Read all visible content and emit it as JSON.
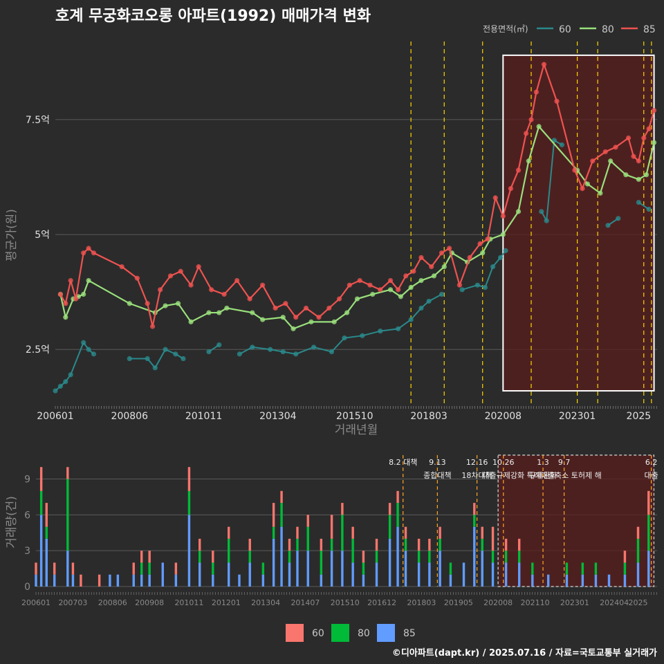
{
  "title": "호계 무궁화코오롱 아파트(1992) 매매가격 변화",
  "caption": "©디아파트(dapt.kr) / 2025.07.16 / 자료=국토교통부 실거래가",
  "colors": {
    "background": "#2b2b2b",
    "s60": "#2a8a8c",
    "s80": "#9ae07c",
    "s85": "#ef5350",
    "bar60": "#f8766d",
    "bar80": "#00ba38",
    "bar85": "#619cff",
    "event": "#ffd700",
    "highlight": "#5a1e1e"
  },
  "chart_data": [
    {
      "type": "line",
      "title": "호계 무궁화코오롱 아파트(1992) 매매가격 변화",
      "xlabel": "거래년월",
      "ylabel": "평균가(원)",
      "y_unit": "억",
      "ylim": [
        1.3,
        9.5
      ],
      "xlim": [
        "2006-01",
        "2025-07"
      ],
      "x_ticks": [
        "200601",
        "200806",
        "201011",
        "201304",
        "201510",
        "201803",
        "202008",
        "202301",
        "2025"
      ],
      "y_ticks": [
        {
          "value": 2.5,
          "label": "2.5억"
        },
        {
          "value": 5,
          "label": "5억"
        },
        {
          "value": 7.5,
          "label": "7.5억"
        }
      ],
      "grid": true,
      "legend": {
        "title": "전용면적(㎡)",
        "position": "top-right",
        "entries": [
          "60",
          "80",
          "85"
        ]
      },
      "highlight_box": {
        "from": "2020-08",
        "to": "2025-07",
        "ymin": 1.6,
        "ymax": 8.9
      },
      "event_lines": [
        "2017-08",
        "2018-09",
        "2019-12",
        "2021-07",
        "2023-01",
        "2023-09",
        "2025-03",
        "2025-06"
      ],
      "series": [
        {
          "name": "60",
          "points": [
            [
              "2006-01",
              1.6
            ],
            [
              "2006-03",
              1.7
            ],
            [
              "2006-05",
              1.8
            ],
            [
              "2006-07",
              1.95
            ],
            [
              "2006-12",
              2.65
            ],
            [
              "2007-02",
              2.5
            ],
            [
              "2007-04",
              2.4
            ],
            [
              "2008-06",
              2.3
            ],
            [
              "2009-01",
              2.3
            ],
            [
              "2009-04",
              2.1
            ],
            [
              "2009-08",
              2.5
            ],
            [
              "2009-12",
              2.4
            ],
            [
              "2010-03",
              2.3
            ],
            [
              "2011-01",
              2.45
            ],
            [
              "2011-05",
              2.6
            ],
            [
              "2012-01",
              2.4
            ],
            [
              "2012-06",
              2.55
            ],
            [
              "2013-01",
              2.5
            ],
            [
              "2013-06",
              2.45
            ],
            [
              "2013-11",
              2.4
            ],
            [
              "2014-06",
              2.55
            ],
            [
              "2015-01",
              2.45
            ],
            [
              "2015-06",
              2.75
            ],
            [
              "2016-01",
              2.8
            ],
            [
              "2016-08",
              2.9
            ],
            [
              "2017-03",
              2.95
            ],
            [
              "2017-08",
              3.15
            ],
            [
              "2017-12",
              3.4
            ],
            [
              "2018-03",
              3.55
            ],
            [
              "2018-08",
              3.7
            ],
            [
              "2019-04",
              3.8
            ],
            [
              "2019-10",
              3.9
            ],
            [
              "2020-01",
              3.85
            ],
            [
              "2020-04",
              4.3
            ],
            [
              "2020-07",
              4.5
            ],
            [
              "2020-09",
              4.65
            ],
            [
              "2021-11",
              5.5
            ],
            [
              "2022-01",
              5.3
            ],
            [
              "2022-04",
              7.05
            ],
            [
              "2022-07",
              6.95
            ],
            [
              "2024-01",
              5.2
            ],
            [
              "2024-05",
              5.35
            ],
            [
              "2025-01",
              5.7
            ],
            [
              "2025-05",
              5.55
            ]
          ]
        },
        {
          "name": "80",
          "points": [
            [
              "2006-03",
              3.7
            ],
            [
              "2006-05",
              3.2
            ],
            [
              "2006-08",
              3.6
            ],
            [
              "2006-10",
              3.65
            ],
            [
              "2006-12",
              3.7
            ],
            [
              "2007-02",
              4.0
            ],
            [
              "2008-06",
              3.5
            ],
            [
              "2009-04",
              3.3
            ],
            [
              "2009-08",
              3.45
            ],
            [
              "2010-01",
              3.5
            ],
            [
              "2010-06",
              3.1
            ],
            [
              "2011-01",
              3.3
            ],
            [
              "2011-05",
              3.3
            ],
            [
              "2011-08",
              3.4
            ],
            [
              "2012-06",
              3.3
            ],
            [
              "2012-10",
              3.15
            ],
            [
              "2013-06",
              3.2
            ],
            [
              "2013-10",
              2.95
            ],
            [
              "2014-05",
              3.1
            ],
            [
              "2015-02",
              3.1
            ],
            [
              "2015-07",
              3.3
            ],
            [
              "2015-11",
              3.6
            ],
            [
              "2016-05",
              3.7
            ],
            [
              "2016-12",
              3.8
            ],
            [
              "2017-04",
              3.65
            ],
            [
              "2017-08",
              3.85
            ],
            [
              "2017-12",
              4.0
            ],
            [
              "2018-05",
              4.1
            ],
            [
              "2018-09",
              4.3
            ],
            [
              "2018-12",
              4.6
            ],
            [
              "2019-06",
              4.4
            ],
            [
              "2019-12",
              4.6
            ],
            [
              "2020-03",
              4.9
            ],
            [
              "2020-08",
              5.0
            ],
            [
              "2021-02",
              5.5
            ],
            [
              "2021-06",
              6.6
            ],
            [
              "2021-10",
              7.35
            ],
            [
              "2023-01",
              6.4
            ],
            [
              "2023-05",
              6.1
            ],
            [
              "2023-10",
              5.9
            ],
            [
              "2024-02",
              6.6
            ],
            [
              "2024-08",
              6.3
            ],
            [
              "2025-01",
              6.2
            ],
            [
              "2025-04",
              6.3
            ],
            [
              "2025-07",
              7.0
            ]
          ]
        },
        {
          "name": "85",
          "points": [
            [
              "2006-03",
              3.7
            ],
            [
              "2006-05",
              3.5
            ],
            [
              "2006-07",
              4.0
            ],
            [
              "2006-09",
              3.6
            ],
            [
              "2006-12",
              4.6
            ],
            [
              "2007-02",
              4.7
            ],
            [
              "2007-04",
              4.6
            ],
            [
              "2008-03",
              4.3
            ],
            [
              "2008-09",
              4.05
            ],
            [
              "2009-01",
              3.5
            ],
            [
              "2009-03",
              3.0
            ],
            [
              "2009-06",
              3.8
            ],
            [
              "2009-10",
              4.1
            ],
            [
              "2010-02",
              4.2
            ],
            [
              "2010-06",
              3.9
            ],
            [
              "2010-09",
              4.3
            ],
            [
              "2011-02",
              3.8
            ],
            [
              "2011-07",
              3.7
            ],
            [
              "2011-12",
              4.0
            ],
            [
              "2012-05",
              3.6
            ],
            [
              "2012-10",
              3.9
            ],
            [
              "2013-03",
              3.4
            ],
            [
              "2013-07",
              3.5
            ],
            [
              "2013-11",
              3.2
            ],
            [
              "2014-03",
              3.4
            ],
            [
              "2014-08",
              3.2
            ],
            [
              "2014-12",
              3.4
            ],
            [
              "2015-04",
              3.6
            ],
            [
              "2015-08",
              3.9
            ],
            [
              "2015-12",
              4.0
            ],
            [
              "2016-04",
              3.9
            ],
            [
              "2016-08",
              3.8
            ],
            [
              "2016-12",
              4.0
            ],
            [
              "2017-03",
              3.8
            ],
            [
              "2017-06",
              4.1
            ],
            [
              "2017-09",
              4.2
            ],
            [
              "2017-12",
              4.5
            ],
            [
              "2018-04",
              4.3
            ],
            [
              "2018-08",
              4.6
            ],
            [
              "2018-11",
              4.7
            ],
            [
              "2019-03",
              3.9
            ],
            [
              "2019-07",
              4.5
            ],
            [
              "2019-11",
              4.8
            ],
            [
              "2020-02",
              4.9
            ],
            [
              "2020-05",
              5.8
            ],
            [
              "2020-08",
              5.4
            ],
            [
              "2020-11",
              6.0
            ],
            [
              "2021-02",
              6.4
            ],
            [
              "2021-05",
              7.2
            ],
            [
              "2021-07",
              7.5
            ],
            [
              "2021-09",
              8.1
            ],
            [
              "2021-12",
              8.7
            ],
            [
              "2022-05",
              7.9
            ],
            [
              "2022-12",
              6.4
            ],
            [
              "2023-03",
              6.0
            ],
            [
              "2023-07",
              6.6
            ],
            [
              "2023-12",
              6.8
            ],
            [
              "2024-04",
              6.9
            ],
            [
              "2024-09",
              7.1
            ],
            [
              "2024-11",
              6.7
            ],
            [
              "2025-01",
              6.6
            ],
            [
              "2025-03",
              7.1
            ],
            [
              "2025-05",
              7.3
            ],
            [
              "2025-07",
              7.7
            ]
          ]
        }
      ]
    },
    {
      "type": "bar",
      "xlabel": "",
      "ylabel": "거래량(건)",
      "ylim": [
        0,
        11
      ],
      "y_ticks": [
        0,
        3,
        6,
        9
      ],
      "x_ticks": [
        "200601",
        "200703",
        "200806",
        "200908",
        "201011",
        "201201",
        "201304",
        "201407",
        "201510",
        "201612",
        "201803",
        "201905",
        "202008",
        "202110",
        "202301",
        "202404",
        "2025"
      ],
      "legend": {
        "position": "bottom",
        "entries": [
          "60",
          "80",
          "85"
        ]
      },
      "highlight_box": {
        "from": "2020-08",
        "to": "2025-07"
      },
      "events": [
        {
          "date": "2017-08",
          "line1": "8.2 대책",
          "line2": ""
        },
        {
          "date": "2018-09",
          "line1": "9.13",
          "line2": "종합대책"
        },
        {
          "date": "2019-12",
          "line1": "12.16",
          "line2": "18차대책"
        },
        {
          "date": "2020-10",
          "line1": "10.26",
          "line2": "대출규제강화"
        },
        {
          "date": "2022-01",
          "line1": "1.3",
          "line2": "규제완화"
        },
        {
          "date": "2022-09",
          "line1": "9.7",
          "line2": "특례대출축소 토허제 해"
        },
        {
          "date": "2025-06",
          "line1": "6.2",
          "line2": "대출"
        }
      ],
      "stacks": [
        [
          "2006-01",
          1,
          0,
          1
        ],
        [
          "2006-03",
          2,
          2,
          6
        ],
        [
          "2006-05",
          2,
          1,
          4
        ],
        [
          "2006-08",
          1,
          0,
          1
        ],
        [
          "2007-01",
          1,
          6,
          3
        ],
        [
          "2007-03",
          1,
          0,
          1
        ],
        [
          "2007-06",
          1,
          0,
          0
        ],
        [
          "2008-01",
          1,
          0,
          0
        ],
        [
          "2008-05",
          0,
          0,
          1
        ],
        [
          "2008-08",
          0,
          0,
          1
        ],
        [
          "2009-02",
          1,
          0,
          1
        ],
        [
          "2009-05",
          1,
          1,
          1
        ],
        [
          "2009-08",
          1,
          1,
          1
        ],
        [
          "2010-01",
          0,
          0,
          2
        ],
        [
          "2010-06",
          1,
          0,
          1
        ],
        [
          "2010-11",
          2,
          2,
          6
        ],
        [
          "2011-03",
          1,
          1,
          2
        ],
        [
          "2011-08",
          1,
          1,
          1
        ],
        [
          "2012-02",
          1,
          2,
          2
        ],
        [
          "2012-06",
          0,
          0,
          1
        ],
        [
          "2012-10",
          1,
          1,
          2
        ],
        [
          "2013-03",
          0,
          1,
          1
        ],
        [
          "2013-07",
          2,
          1,
          4
        ],
        [
          "2013-10",
          1,
          2,
          5
        ],
        [
          "2014-01",
          1,
          1,
          2
        ],
        [
          "2014-04",
          1,
          1,
          3
        ],
        [
          "2014-08",
          1,
          2,
          3
        ],
        [
          "2015-01",
          1,
          2,
          1
        ],
        [
          "2015-05",
          2,
          1,
          3
        ],
        [
          "2015-09",
          1,
          3,
          3
        ],
        [
          "2016-01",
          1,
          2,
          2
        ],
        [
          "2016-05",
          1,
          1,
          1
        ],
        [
          "2016-10",
          1,
          1,
          2
        ],
        [
          "2017-03",
          1,
          2,
          4
        ],
        [
          "2017-06",
          1,
          2,
          5
        ],
        [
          "2017-09",
          1,
          1,
          3
        ],
        [
          "2018-02",
          1,
          1,
          2
        ],
        [
          "2018-06",
          1,
          1,
          2
        ],
        [
          "2018-10",
          1,
          1,
          3
        ],
        [
          "2019-02",
          0,
          1,
          1
        ],
        [
          "2019-07",
          0,
          0,
          2
        ],
        [
          "2019-11",
          1,
          1,
          5
        ],
        [
          "2020-02",
          1,
          1,
          3
        ],
        [
          "2020-06",
          2,
          1,
          2
        ],
        [
          "2020-11",
          1,
          1,
          2
        ],
        [
          "2021-04",
          1,
          1,
          2
        ],
        [
          "2021-09",
          0,
          1,
          1
        ],
        [
          "2022-03",
          0,
          0,
          1
        ],
        [
          "2022-10",
          0,
          1,
          1
        ],
        [
          "2023-04",
          0,
          1,
          1
        ],
        [
          "2023-09",
          0,
          1,
          1
        ],
        [
          "2024-02",
          0,
          0,
          1
        ],
        [
          "2024-08",
          1,
          1,
          1
        ],
        [
          "2025-01",
          1,
          2,
          2
        ],
        [
          "2025-05",
          2,
          3,
          3
        ]
      ]
    }
  ]
}
